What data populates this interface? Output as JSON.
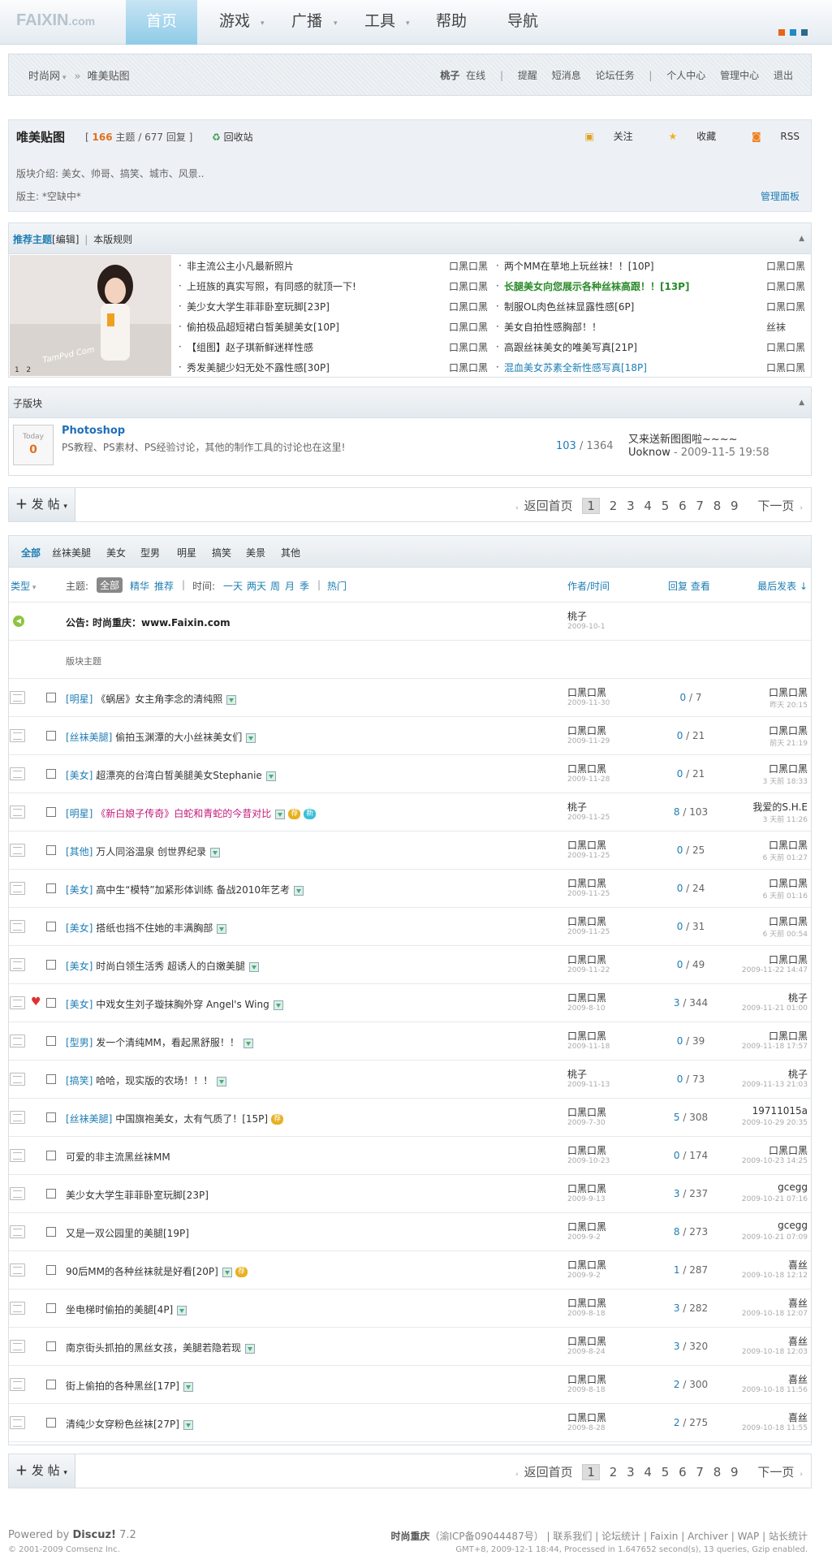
{
  "nav": {
    "logo": "FAIXIN",
    "logo_suffix": ".com",
    "items": [
      "首页",
      "游戏",
      "广播",
      "工具",
      "帮助",
      "导航"
    ],
    "active": "首页"
  },
  "crumb": {
    "site": "时尚网",
    "forum": "唯美贴图",
    "user": "桃子",
    "status": "在线",
    "links": [
      "提醒",
      "短消息",
      "论坛任务",
      "个人中心",
      "管理中心",
      "退出"
    ]
  },
  "forum": {
    "title": "唯美贴图",
    "threads": "166",
    "threads_label": "主题",
    "posts": "677",
    "posts_label": "回复",
    "recycle": "回收站",
    "desc": "版块介绍: 美女、帅哥、搞笑、城市、风景..",
    "moderator": "版主: *空缺中*",
    "manage": "管理面板",
    "actions": [
      "关注",
      "收藏",
      "RSS"
    ]
  },
  "recommend": {
    "head": "推荐主题",
    "edit": "[编辑]",
    "rules": "本版规则",
    "pic_caption": "TamPvd Com",
    "pic_pages": [
      "1",
      "2"
    ],
    "left": [
      {
        "title": "非主流公主小凡最新照片",
        "author": "口黑口黑"
      },
      {
        "title": "上班族的真实写照，有同感的就顶一下!",
        "author": "口黑口黑"
      },
      {
        "title": "美少女大学生菲菲卧室玩脚[23P]",
        "author": "口黑口黑"
      },
      {
        "title": "偷拍极品超短裙白皙美腿美女[10P]",
        "author": "口黑口黑"
      },
      {
        "title": "【组图】赵子琪新鲜迷样性感",
        "author": "口黑口黑"
      },
      {
        "title": "秀发美腿少妇无处不露性感[30P]",
        "author": "口黑口黑"
      }
    ],
    "right": [
      {
        "title": "两个MM在草地上玩丝袜！！[10P]",
        "author": "口黑口黑",
        "color": "#333"
      },
      {
        "title": "长腿美女向您展示各种丝袜高跟！！[13P]",
        "author": "口黑口黑",
        "color": "#2a8a2a"
      },
      {
        "title": "制服OL肉色丝袜显露性感[6P]",
        "author": "口黑口黑",
        "color": "#333"
      },
      {
        "title": "美女自拍性感胸部！！",
        "author": "丝袜",
        "color": "#333"
      },
      {
        "title": "高跟丝袜美女的唯美写真[21P]",
        "author": "口黑口黑",
        "color": "#333"
      },
      {
        "title": "混血美女苏素全新性感写真[18P]",
        "author": "口黑口黑",
        "color": "#1f7db3"
      }
    ]
  },
  "subforum": {
    "head": "子版块",
    "today_label": "Today",
    "today_count": "0",
    "name": "Photoshop",
    "desc": "PS教程、PS素材、PS经验讨论，其他的制作工具的讨论也在这里!",
    "threads": "103",
    "posts": "1364",
    "last_title": "又来送新图图啦~~~~",
    "last_by": "Uoknow",
    "last_time": "2009-11-5 19:58"
  },
  "postbar": {
    "post": "发 帖",
    "back": "返回首页",
    "pages": [
      "1",
      "2",
      "3",
      "4",
      "5",
      "6",
      "7",
      "8",
      "9"
    ],
    "next": "下一页"
  },
  "filter": {
    "types": [
      "全部",
      "丝袜美腿",
      "美女",
      "型男",
      "明星",
      "搞笑",
      "美景",
      "其他"
    ],
    "type_label": "类型",
    "topic_label": "主题:",
    "topic_all": "全部",
    "topic_opts": [
      "精华",
      "推荐"
    ],
    "time_label": "时间:",
    "time_opts": [
      "一天",
      "两天",
      "周",
      "月",
      "季"
    ],
    "hot": "热门",
    "col_author": "作者/时间",
    "col_replies": "回复 查看",
    "col_last": "最后发表"
  },
  "announce": {
    "label": "公告:",
    "text": "时尚重庆：www.Faixin.com",
    "author": "桃子",
    "date": "2009-10-1"
  },
  "section_label": "版块主题",
  "threads": [
    {
      "type": "[明星]",
      "title": "《蜗居》女主角李念的清纯照",
      "title_color": "#333",
      "author": "口黑口黑",
      "date": "2009-11-30",
      "replies": "0",
      "views": "7",
      "last": "口黑口黑",
      "last_time": "昨天 20:15",
      "att": true,
      "badges": [],
      "heart": false,
      "cb": true
    },
    {
      "type": "[丝袜美腿]",
      "title": "偷拍玉渊潭的大小丝袜美女们",
      "title_color": "#333",
      "author": "口黑口黑",
      "date": "2009-11-29",
      "replies": "0",
      "views": "21",
      "last": "口黑口黑",
      "last_time": "前天 21:19",
      "att": true,
      "badges": [],
      "heart": false,
      "cb": true
    },
    {
      "type": "[美女]",
      "title": "超漂亮的台湾白皙美腿美女Stephanie",
      "title_color": "#333",
      "author": "口黑口黑",
      "date": "2009-11-28",
      "replies": "0",
      "views": "21",
      "last": "口黑口黑",
      "last_time": "3 天前 18:33",
      "att": true,
      "badges": [],
      "heart": false,
      "cb": true
    },
    {
      "type": "[明星]",
      "title": "《新白娘子传奇》白蛇和青蛇的今昔对比",
      "title_color": "#c2187a",
      "author": "桃子",
      "date": "2009-11-25",
      "replies": "8",
      "views": "103",
      "last": "我爱的S.H.E",
      "last_time": "3 天前 11:26",
      "att": true,
      "badges": [
        "荐",
        "新"
      ],
      "heart": false,
      "cb": true
    },
    {
      "type": "[其他]",
      "title": "万人同浴温泉 创世界纪录",
      "title_color": "#333",
      "author": "口黑口黑",
      "date": "2009-11-25",
      "replies": "0",
      "views": "25",
      "last": "口黑口黑",
      "last_time": "6 天前 01:27",
      "att": true,
      "badges": [],
      "heart": false,
      "cb": true
    },
    {
      "type": "[美女]",
      "title": "高中生“模特”加紧形体训练 备战2010年艺考",
      "title_color": "#333",
      "author": "口黑口黑",
      "date": "2009-11-25",
      "replies": "0",
      "views": "24",
      "last": "口黑口黑",
      "last_time": "6 天前 01:16",
      "att": true,
      "badges": [],
      "heart": false,
      "cb": true
    },
    {
      "type": "[美女]",
      "title": "搭纸也挡不住她的丰满胸部",
      "title_color": "#333",
      "author": "口黑口黑",
      "date": "2009-11-25",
      "replies": "0",
      "views": "31",
      "last": "口黑口黑",
      "last_time": "6 天前 00:54",
      "att": true,
      "badges": [],
      "heart": false,
      "cb": true
    },
    {
      "type": "[美女]",
      "title": "时尚白领生活秀 超诱人的白嫩美腿",
      "title_color": "#333",
      "author": "口黑口黑",
      "date": "2009-11-22",
      "replies": "0",
      "views": "49",
      "last": "口黑口黑",
      "last_time": "2009-11-22 14:47",
      "att": true,
      "badges": [],
      "heart": false,
      "cb": true
    },
    {
      "type": "[美女]",
      "title": "中戏女生刘子璇抹胸外穿 Angel's Wing",
      "title_color": "#333",
      "author": "口黑口黑",
      "date": "2009-8-10",
      "replies": "3",
      "views": "344",
      "last": "桃子",
      "last_time": "2009-11-21 01:00",
      "att": true,
      "badges": [],
      "heart": true,
      "cb": true
    },
    {
      "type": "[型男]",
      "title": "发一个清纯MM，看起黑舒服！！",
      "title_color": "#333",
      "author": "口黑口黑",
      "date": "2009-11-18",
      "replies": "0",
      "views": "39",
      "last": "口黑口黑",
      "last_time": "2009-11-18 17:57",
      "att": true,
      "badges": [],
      "heart": false,
      "cb": true
    },
    {
      "type": "[搞笑]",
      "title": "哈哈，现实版的农场！！！",
      "title_color": "#333",
      "author": "桃子",
      "date": "2009-11-13",
      "replies": "0",
      "views": "73",
      "last": "桃子",
      "last_time": "2009-11-13 21:03",
      "att": true,
      "badges": [],
      "heart": false,
      "cb": true
    },
    {
      "type": "[丝袜美腿]",
      "title": "中国旗袍美女，太有气质了！[15P]",
      "title_color": "#333",
      "author": "口黑口黑",
      "date": "2009-7-30",
      "replies": "5",
      "views": "308",
      "last": "19711015a",
      "last_time": "2009-10-29 20:35",
      "att": false,
      "badges": [
        "荐"
      ],
      "heart": false,
      "cb": true
    },
    {
      "type": "",
      "title": "可爱的非主流黑丝袜MM",
      "title_color": "#333",
      "author": "口黑口黑",
      "date": "2009-10-23",
      "replies": "0",
      "views": "174",
      "last": "口黑口黑",
      "last_time": "2009-10-23 14:25",
      "att": false,
      "badges": [],
      "heart": false,
      "cb": true
    },
    {
      "type": "",
      "title": "美少女大学生菲菲卧室玩脚[23P]",
      "title_color": "#333",
      "author": "口黑口黑",
      "date": "2009-9-13",
      "replies": "3",
      "views": "237",
      "last": "gcegg",
      "last_time": "2009-10-21 07:16",
      "att": false,
      "badges": [],
      "heart": false,
      "cb": true
    },
    {
      "type": "",
      "title": "又是一双公园里的美腿[19P]",
      "title_color": "#333",
      "author": "口黑口黑",
      "date": "2009-9-2",
      "replies": "8",
      "views": "273",
      "last": "gcegg",
      "last_time": "2009-10-21 07:09",
      "att": false,
      "badges": [],
      "heart": false,
      "cb": true
    },
    {
      "type": "",
      "title": "90后MM的各种丝袜就是好看[20P]",
      "title_color": "#333",
      "author": "口黑口黑",
      "date": "2009-9-2",
      "replies": "1",
      "views": "287",
      "last": "喜丝",
      "last_time": "2009-10-18 12:12",
      "att": true,
      "badges": [
        "荐"
      ],
      "heart": false,
      "cb": true
    },
    {
      "type": "",
      "title": "坐电梯时偷拍的美腿[4P]",
      "title_color": "#333",
      "author": "口黑口黑",
      "date": "2009-8-18",
      "replies": "3",
      "views": "282",
      "last": "喜丝",
      "last_time": "2009-10-18 12:07",
      "att": true,
      "badges": [],
      "heart": false,
      "cb": true
    },
    {
      "type": "",
      "title": "南京街头抓拍的黑丝女孩，美腿若隐若现",
      "title_color": "#333",
      "author": "口黑口黑",
      "date": "2009-8-24",
      "replies": "3",
      "views": "320",
      "last": "喜丝",
      "last_time": "2009-10-18 12:03",
      "att": true,
      "badges": [],
      "heart": false,
      "cb": true
    },
    {
      "type": "",
      "title": "街上偷拍的各种黑丝[17P]",
      "title_color": "#333",
      "author": "口黑口黑",
      "date": "2009-8-18",
      "replies": "2",
      "views": "300",
      "last": "喜丝",
      "last_time": "2009-10-18 11:56",
      "att": true,
      "badges": [],
      "heart": false,
      "cb": true
    },
    {
      "type": "",
      "title": "清纯少女穿粉色丝袜[27P]",
      "title_color": "#333",
      "author": "口黑口黑",
      "date": "2009-8-28",
      "replies": "2",
      "views": "275",
      "last": "喜丝",
      "last_time": "2009-10-18 11:55",
      "att": true,
      "badges": [],
      "heart": false,
      "cb": true
    }
  ],
  "footer": {
    "powered": "Powered by",
    "brand": "Discuz!",
    "version": "7.2",
    "copyright": "© 2001-2009 Comsenz Inc.",
    "site": "时尚重庆",
    "icp": "（渝ICP备09044487号）",
    "links": [
      "联系我们",
      "论坛统计",
      "Faixin",
      "Archiver",
      "WAP",
      "站长统计"
    ],
    "stats": "GMT+8, 2009-12-1 18:44, Processed in 1.647652 second(s), 13 queries, Gzip enabled."
  }
}
